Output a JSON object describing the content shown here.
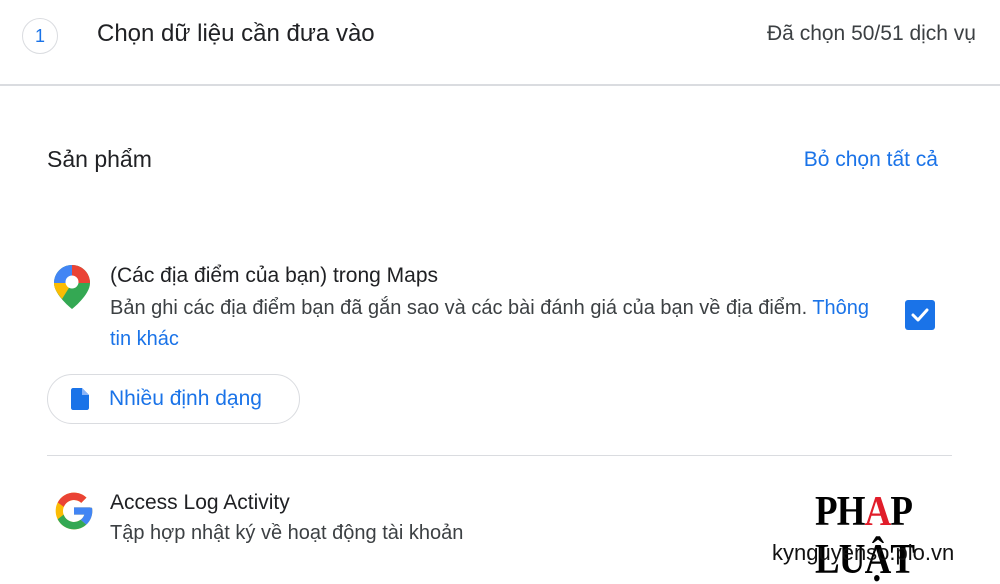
{
  "header": {
    "step_number": "1",
    "title": "Chọn dữ liệu cần đưa vào",
    "selected_count": "Đã chọn 50/51 dịch vụ"
  },
  "section": {
    "title": "Sản phẩm",
    "deselect_all": "Bỏ chọn tất cả"
  },
  "products": [
    {
      "name": "(Các địa điểm của bạn) trong Maps",
      "description": "Bản ghi các địa điểm bạn đã gắn sao và các bài đánh giá của bạn về địa điểm.",
      "more_info": "Thông tin khác",
      "format_label": "Nhiều định dạng",
      "checked": true,
      "icon": "google-maps-pin-icon"
    },
    {
      "name": "Access Log Activity",
      "description": "Tập hợp nhật ký về hoạt động tài khoản",
      "icon": "google-g-icon"
    }
  ],
  "watermark": {
    "brand_part1": "PH",
    "brand_a": "A",
    "brand_part2": "P LUẬT",
    "url": "kynguyenso.plo.vn"
  },
  "colors": {
    "accent": "#1a73e8",
    "divider": "#dadce0"
  }
}
